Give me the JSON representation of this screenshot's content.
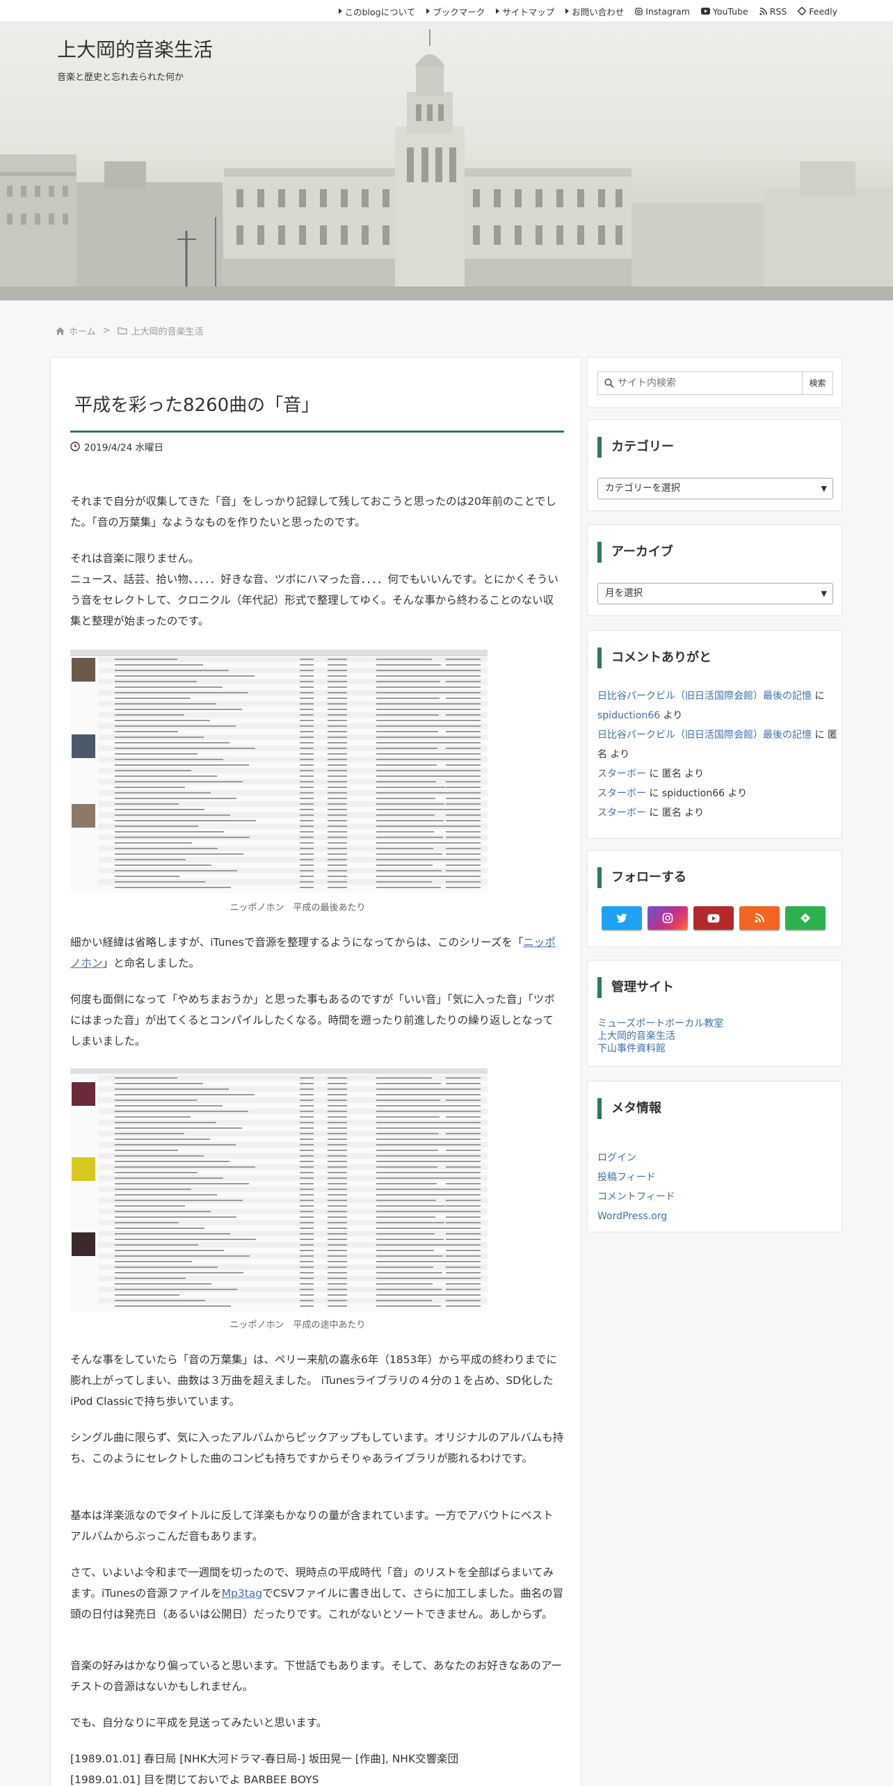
{
  "topnav": {
    "items": [
      {
        "label": "このblogについて",
        "icon": "triangle-right-icon"
      },
      {
        "label": "ブックマーク",
        "icon": "triangle-right-icon"
      },
      {
        "label": "サイトマップ",
        "icon": "triangle-right-icon"
      },
      {
        "label": "お問い合わせ",
        "icon": "triangle-right-icon"
      },
      {
        "label": "Instagram",
        "icon": "instagram-icon"
      },
      {
        "label": "YouTube",
        "icon": "youtube-icon"
      },
      {
        "label": "RSS",
        "icon": "rss-icon"
      },
      {
        "label": "Feedly",
        "icon": "feedly-icon"
      }
    ]
  },
  "header": {
    "site_title": "上大岡的音楽生活",
    "site_description": "音楽と歴史と忘れ去られた何か"
  },
  "breadcrumb": {
    "home": "ホーム",
    "separator": ">",
    "category": "上大岡的音楽生活"
  },
  "post": {
    "title": "平成を彩った8260曲の「音」",
    "date": "2019/4/24 水曜日",
    "paragraphs": {
      "p1": "それまで自分が収集してきた「音」をしっかり記録して残しておこうと思ったのは20年前のことでした。「音の万葉集」なようなものを作りたいと思ったのです。",
      "p2a": "それは音楽に限りません。",
      "p2b": "ニュース、話芸、拾い物、．．．．好きな音、ツボにハマった音．．．．何でもいいんです。とにかくそういう音をセレクトして、クロニクル（年代記）形式で整理してゆく。そんな事から終わることのない収集と整理が始まったのです。",
      "p3_before": "細かい経緯は省略しますが、iTunesで音源を整理するようになってからは、このシリーズを「",
      "p3_link": "ニッポノホン",
      "p3_after": "」と命名しました。",
      "p4": "何度も面倒になって「やめちまおうか」と思った事もあるのですが「いい音」「気に入った音」「ツボにはまった音」が出てくるとコンパイルしたくなる。時間を遡ったり前進したりの繰り返しとなってしまいました。",
      "p5": "そんな事をしていたら「音の万葉集」は、ペリー来航の嘉永6年（1853年）から平成の終わりまでに膨れ上がってしまい、曲数は３万曲を超えました。 iTunesライブラリの４分の１を占め、SD化したiPod Classicで持ち歩いています。",
      "p6": "シングル曲に限らず、気に入ったアルバムからピックアップもしています。オリジナルのアルバムも持ち、このようにセレクトした曲のコンピも持ちですからそりゃあライブラリが膨れるわけです。",
      "p7": "基本は洋楽派なのでタイトルに反して洋楽もかなりの量が含まれています。一方でアバウトにベストアルバムからぶっこんだ音もあります。",
      "p8_before": "さて、いよいよ令和まで一週間を切ったので、現時点の平成時代「音」のリストを全部ばらまいてみます。iTunesの音源ファイルを",
      "p8_link": "Mp3tag",
      "p8_after": "でCSVファイルに書き出して、さらに加工しました。曲名の冒頭の日付は発売日（あるいは公開日）だったりです。これがないとソートできません。あしからず。",
      "p9": "音楽の好みはかなり偏っていると思います。下世話でもあります。そして、あなたのお好きなあのアーチストの音源はないかもしれません。",
      "p10": "でも、自分なりに平成を見送ってみたいと思います。",
      "list1": "[1989.01.01] 春日局 [NHK大河ドラマ-春日局-] 坂田晃一 [作曲], NHK交響楽団",
      "list2": "[1989.01.01] 目を閉じておいでよ BARBEE BOYS"
    },
    "figure1_caption": "ニッポノホン　平成の最後あたり",
    "figure2_caption": "ニッポノホン　平成の途中あたり"
  },
  "sidebar": {
    "search": {
      "placeholder": "サイト内検索",
      "button": "検索"
    },
    "categories": {
      "title": "カテゴリー",
      "select": "カテゴリーを選択"
    },
    "archive": {
      "title": "アーカイブ",
      "select": "月を選択"
    },
    "comments": {
      "title": "コメントありがと",
      "items": [
        {
          "link": "日比谷パークビル（旧日活国際会館）最後の記憶",
          "mid": " に ",
          "author": "spiduction66",
          "tail": " より"
        },
        {
          "link": "日比谷パークビル（旧日活国際会館）最後の記憶",
          "mid": " に 匿名 より",
          "author": "",
          "tail": ""
        },
        {
          "link": "スターボー",
          "mid": " に 匿名 より",
          "author": "",
          "tail": ""
        },
        {
          "link": "スターボー",
          "mid": " に spiduction66 より",
          "author": "",
          "tail": ""
        },
        {
          "link": "スターボー",
          "mid": " に 匿名 より",
          "author": "",
          "tail": ""
        }
      ]
    },
    "follow": {
      "title": "フォローする",
      "buttons": [
        {
          "name": "twitter",
          "color": "#1da1f2"
        },
        {
          "name": "instagram",
          "color": "#c13584"
        },
        {
          "name": "youtube",
          "color": "#b3292a"
        },
        {
          "name": "rss",
          "color": "#f26522"
        },
        {
          "name": "feedly",
          "color": "#2bb24c"
        }
      ]
    },
    "managed": {
      "title": "管理サイト",
      "links": [
        "ミューズポートボーカル教室",
        "上大岡的音楽生活",
        "下山事件資料館"
      ]
    },
    "meta": {
      "title": "メタ情報",
      "links": [
        "ログイン",
        "投稿フィード",
        "コメントフィード",
        "WordPress.org"
      ]
    }
  },
  "colors": {
    "accent": "#2c7a5a",
    "link": "#3a6fb0"
  }
}
